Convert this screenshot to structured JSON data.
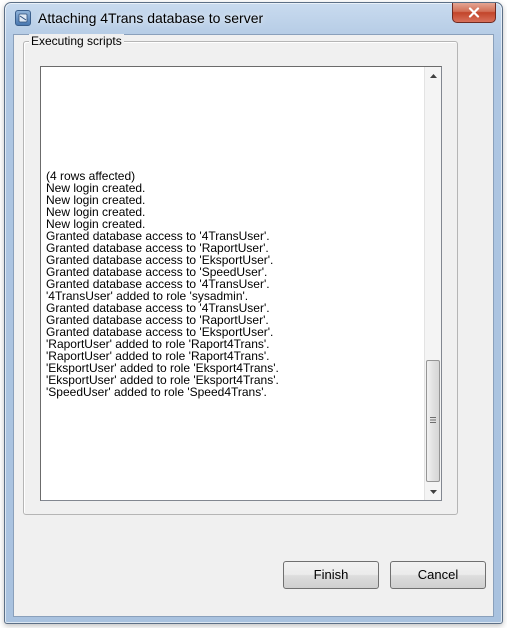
{
  "window": {
    "title": "Attaching 4Trans database to server",
    "icon": "database-attach-icon"
  },
  "group": {
    "label": "Executing scripts"
  },
  "log": {
    "lines": [
      "(4 rows affected)",
      "New login created.",
      "New login created.",
      "New login created.",
      "New login created.",
      "Granted database access to '4TransUser'.",
      "Granted database access to 'RaportUser'.",
      "Granted database access to 'EksportUser'.",
      "Granted database access to 'SpeedUser'.",
      "Granted database access to '4TransUser'.",
      "'4TransUser' added to role 'sysadmin'.",
      "Granted database access to '4TransUser'.",
      "Granted database access to 'RaportUser'.",
      "Granted database access to 'EksportUser'.",
      "'RaportUser' added to role 'Raport4Trans'.",
      "'RaportUser' added to role 'Raport4Trans'.",
      "'EksportUser' added to role 'Eksport4Trans'.",
      "'EksportUser' added to role 'Eksport4Trans'.",
      "'SpeedUser' added to role 'Speed4Trans'."
    ]
  },
  "buttons": {
    "finish": "Finish",
    "cancel": "Cancel"
  },
  "colors": {
    "title_bar": "#b7cde6",
    "close_button": "#c2442a",
    "dialog_background": "#f0f0f0"
  }
}
